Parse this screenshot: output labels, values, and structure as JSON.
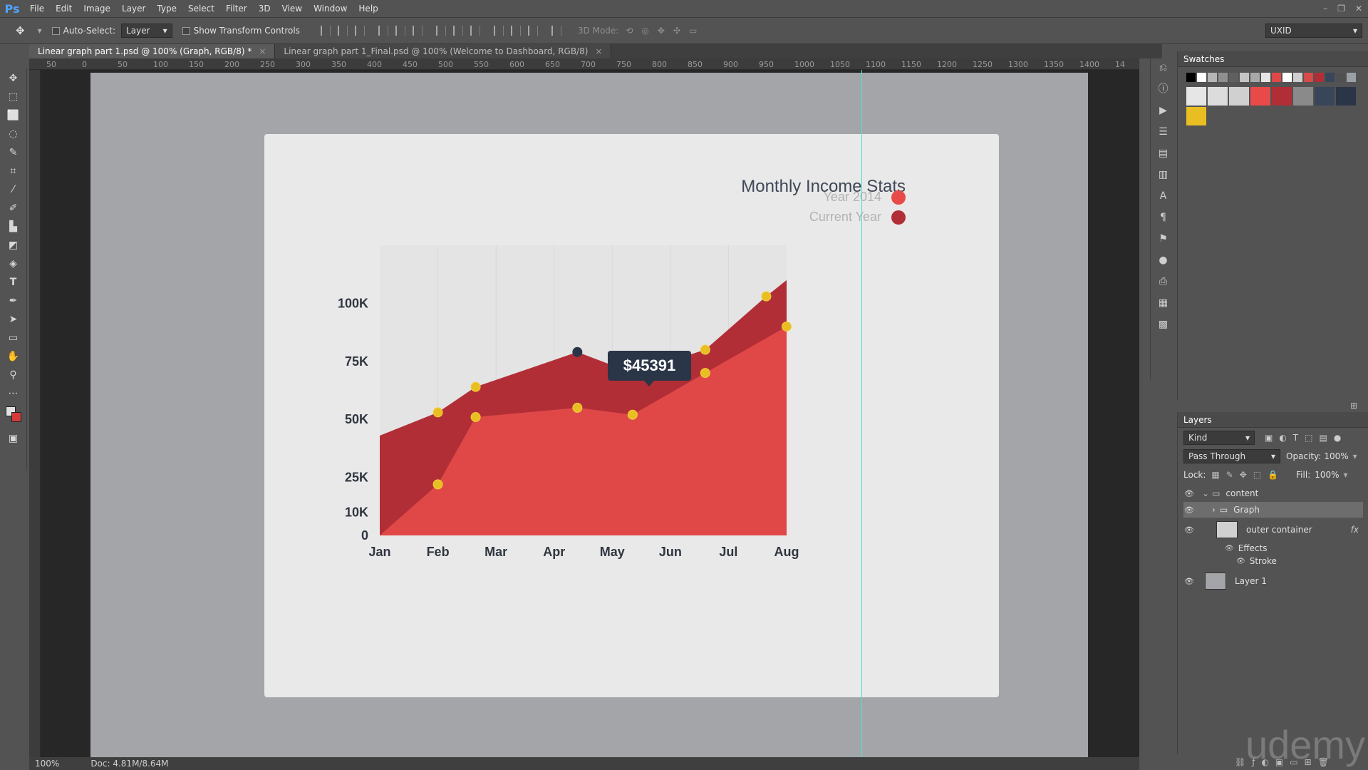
{
  "app": {
    "logo": "Ps",
    "window_controls": [
      "–",
      "❐",
      "✕"
    ]
  },
  "menu": [
    "File",
    "Edit",
    "Image",
    "Layer",
    "Type",
    "Select",
    "Filter",
    "3D",
    "View",
    "Window",
    "Help"
  ],
  "options": {
    "auto_select_label": "Auto-Select:",
    "auto_select_value": "Layer",
    "transform_label": "Show Transform Controls",
    "mode_3d_label": "3D Mode:",
    "workspace": "UXID"
  },
  "tabs": [
    {
      "label": "Linear graph part 1.psd @ 100% (Graph, RGB/8) *",
      "close": "×"
    },
    {
      "label": "Linear graph part 1_Final.psd @ 100% (Welcome to Dashboard, RGB/8)",
      "close": "×"
    }
  ],
  "ruler_top_labels": [
    "50",
    "0",
    "50",
    "100",
    "150",
    "200",
    "250",
    "300",
    "350",
    "400",
    "450",
    "500",
    "550",
    "600",
    "650",
    "700",
    "750",
    "800",
    "850",
    "900",
    "950",
    "1000",
    "1050",
    "1100",
    "1150",
    "1200",
    "1250",
    "1300",
    "1350",
    "1400",
    "14"
  ],
  "chart": {
    "title": "Monthly Income Stats",
    "legend": [
      {
        "label": "Year 2014",
        "color": "#e84a4a"
      },
      {
        "label": "Current Year",
        "color": "#b22e36"
      }
    ],
    "y_labels": [
      "100K",
      "75K",
      "50K",
      "25K",
      "10K",
      "0"
    ],
    "x_labels": [
      "Jan",
      "Feb",
      "Mar",
      "Apr",
      "May",
      "Jun",
      "Jul",
      "Aug"
    ],
    "tooltip": "$45391",
    "colors": {
      "back_area": "#b22e36",
      "front_area": "#e04848",
      "point": "#e8be23",
      "highlight_point": "#2b3548"
    }
  },
  "chart_data": {
    "type": "area",
    "title": "Monthly Income Stats",
    "categories": [
      "Jan",
      "Feb",
      "Mar",
      "Apr",
      "May",
      "Jun",
      "Jul",
      "Aug"
    ],
    "y_tick_labels": [
      "0",
      "10K",
      "25K",
      "50K",
      "75K",
      "100K"
    ],
    "series": [
      {
        "name": "Current Year",
        "points": [
          [
            0,
            43000
          ],
          [
            1,
            53000
          ],
          [
            1.65,
            64000
          ],
          [
            3.4,
            79000
          ],
          [
            4.35,
            70000
          ],
          [
            5.6,
            80000
          ],
          [
            6.65,
            103000
          ],
          [
            7,
            110000
          ]
        ]
      },
      {
        "name": "Year 2014",
        "points": [
          [
            0,
            0
          ],
          [
            1,
            22000
          ],
          [
            1.65,
            51000
          ],
          [
            3.4,
            55000
          ],
          [
            4.35,
            52000
          ],
          [
            5.6,
            70000
          ],
          [
            7,
            90000
          ]
        ]
      }
    ],
    "highlight": {
      "x": 3.4,
      "y": 79000,
      "label": "$45391"
    }
  },
  "swatches": {
    "title": "Swatches",
    "row1": [
      "#000000",
      "#ffffff",
      "#b5b5b5",
      "#8f8f8f",
      "#5f5f5f",
      "#c4c4c4",
      "#a8a8a8",
      "#e6e6e6",
      "#e04848",
      "#ffffff",
      "#cfcfcf",
      "#d64a4a",
      "#b22e36",
      "#39465a",
      "#505050",
      "#9aa0a6"
    ],
    "row2": [
      "#e6e6e6",
      "#dcdcdc",
      "#d0d0d0",
      "#e84a4a",
      "#b22e36",
      "#8a8a8a",
      "#39465a",
      "#2b3548",
      "#e8be23"
    ]
  },
  "layers": {
    "title": "Layers",
    "kind": "Kind",
    "blend": "Pass Through",
    "opacity_label": "Opacity:",
    "opacity": "100%",
    "lock_label": "Lock:",
    "fill_label": "Fill:",
    "fill": "100%",
    "items": [
      {
        "name": "content",
        "type": "group-open"
      },
      {
        "name": "Graph",
        "type": "group",
        "selected": true
      },
      {
        "name": "outer container",
        "type": "layer",
        "fx": "fx"
      },
      {
        "name": "Effects",
        "type": "effects"
      },
      {
        "name": "Stroke",
        "type": "effect"
      },
      {
        "name": "Layer 1",
        "type": "layer"
      }
    ]
  },
  "status": {
    "zoom": "100%",
    "doc": "Doc: 4.81M/8.64M"
  },
  "watermark": "udemy"
}
